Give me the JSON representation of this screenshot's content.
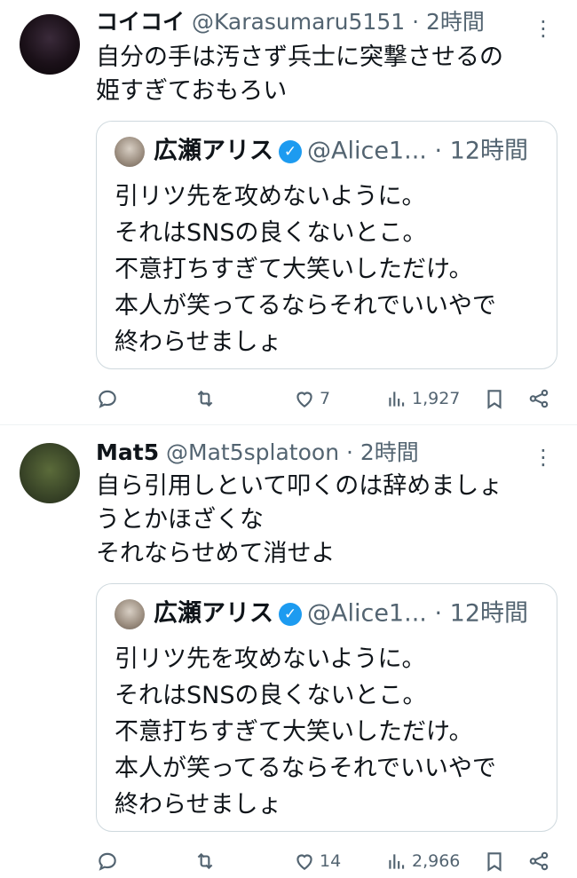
{
  "tweets": [
    {
      "name": "コイコイ",
      "handle": "@Karasumaru5151",
      "dot": "·",
      "time": "2時間",
      "more": "⋮",
      "text": "自分の手は汚さず兵士に突撃させるの\n姫すぎておもろい",
      "quote": {
        "name": "広瀬アリス",
        "verified": "✓",
        "handle": "@Alice1...",
        "dot": "·",
        "time": "12時間",
        "text": "引リツ先を攻めないように。\nそれはSNSの良くないとこ。\n不意打ちすぎて大笑いしただけ。\n本人が笑ってるならそれでいいやで\n終わらせましょ"
      },
      "actions": {
        "replies": "",
        "retweets": "",
        "likes": "7",
        "views": "1,927"
      }
    },
    {
      "name": "Mat5",
      "handle": "@Mat5splatoon",
      "dot": "·",
      "time": "2時間",
      "more": "⋮",
      "text": "自ら引用しといて叩くのは辞めましょ\nうとかほざくな\nそれならせめて消せよ",
      "quote": {
        "name": "広瀬アリス",
        "verified": "✓",
        "handle": "@Alice1...",
        "dot": "·",
        "time": "12時間",
        "text": "引リツ先を攻めないように。\nそれはSNSの良くないとこ。\n不意打ちすぎて大笑いしただけ。\n本人が笑ってるならそれでいいやで\n終わらせましょ"
      },
      "actions": {
        "replies": "",
        "retweets": "",
        "likes": "14",
        "views": "2,966"
      }
    }
  ],
  "icons": {
    "reply": "reply-icon",
    "retweet": "retweet-icon",
    "like": "heart-icon",
    "views": "views-icon",
    "bookmark": "bookmark-icon",
    "share": "share-icon"
  },
  "colors": {
    "text": "#0f1419",
    "muted": "#536471",
    "verified": "#1d9bf0",
    "border": "#cfd9de"
  }
}
